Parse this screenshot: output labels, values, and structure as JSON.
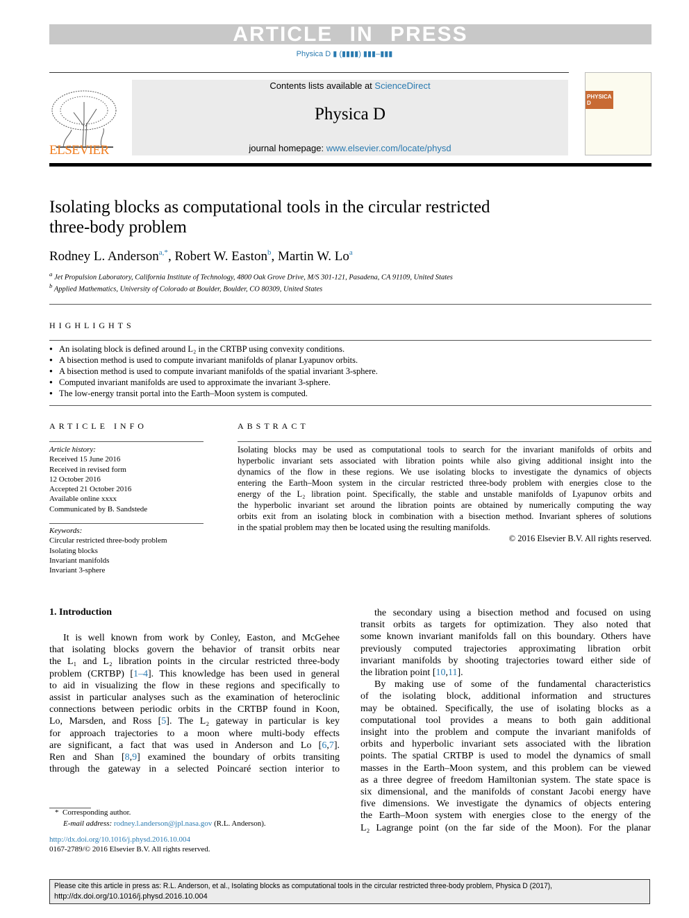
{
  "banner": {
    "article_in_press": "ARTICLE IN PRESS",
    "journal_ref": "Physica D ▮ (▮▮▮▮) ▮▮▮–▮▮▮"
  },
  "masthead": {
    "contents_prefix": "Contents lists available at ",
    "sciencedirect": "ScienceDirect",
    "journal_title": "Physica D",
    "homepage_prefix": "journal homepage: ",
    "homepage_url": "www.elsevier.com/locate/physd",
    "publisher_logo": "ELSEVIER",
    "cover_label": "PHYSICA D"
  },
  "article": {
    "title_lines": [
      "Isolating blocks as computational tools in the circular restricted",
      "three-body problem"
    ],
    "authors": [
      {
        "name": "Rodney L. Anderson",
        "sup": "a,*"
      },
      {
        "name": "Robert W. Easton",
        "sup": "b"
      },
      {
        "name": "Martin W. Lo",
        "sup": "a"
      }
    ],
    "affiliations": [
      {
        "sup": "a",
        "text": "Jet Propulsion Laboratory, California Institute of Technology, 4800 Oak Grove Drive, M/S 301-121, Pasadena, CA 91109, United States"
      },
      {
        "sup": "b",
        "text": "Applied Mathematics, University of Colorado at Boulder, Boulder, CO 80309, United States"
      }
    ]
  },
  "highlights": {
    "heading": "HIGHLIGHTS",
    "items": [
      "An isolating block is defined around L₂ in the CRTBP using convexity conditions.",
      "A bisection method is used to compute invariant manifolds of planar Lyapunov orbits.",
      "A bisection method is used to compute invariant manifolds of the spatial invariant 3-sphere.",
      "Computed invariant manifolds are used to approximate the invariant 3-sphere.",
      "The low-energy transit portal into the Earth–Moon system is computed."
    ]
  },
  "article_info": {
    "heading": "ARTICLE INFO",
    "history_label": "Article history:",
    "history": [
      "Received 15 June 2016",
      "Received in revised form",
      "12 October 2016",
      "Accepted 21 October 2016",
      "Available online xxxx",
      "Communicated by B. Sandstede"
    ],
    "keywords_label": "Keywords:",
    "keywords": [
      "Circular restricted three-body problem",
      "Isolating blocks",
      "Invariant manifolds",
      "Invariant 3-sphere"
    ]
  },
  "abstract": {
    "heading": "ABSTRACT",
    "paragraphs": [
      [
        [
          "Isolating blocks may be used as computational tools to search for the invariant manifolds of orbits and"
        ],
        [
          "hyperbolic invariant sets associated with libration points while also giving additional insight into the"
        ],
        [
          "dynamics of the flow in these regions. We use isolating blocks to investigate the dynamics of objects"
        ],
        [
          "entering the Earth–Moon system in the circular restricted three-body problem with energies close to the"
        ],
        [
          "energy of the L₂ libration point. Specifically, the stable and unstable manifolds of Lyapunov orbits and"
        ],
        [
          "the hyperbolic invariant set around the libration points are obtained by numerically computing the way"
        ],
        [
          "orbits exit from an isolating block in combination with a bisection method. Invariant spheres of solutions"
        ],
        [
          "in the spatial problem may then be located using the resulting manifolds."
        ]
      ]
    ],
    "copyright": "© 2016 Elsevier B.V. All rights reserved."
  },
  "intro": {
    "heading": "1.  Introduction",
    "left": [
      [
        [
          "It is well known from work by Conley, Easton, and McGehee"
        ],
        [
          "that isolating blocks govern the behavior of transit orbits near"
        ],
        [
          "the L₁ and L₂ libration points in the circular restricted three-body"
        ],
        [
          "problem (CRTBP) [",
          {
            "t": "1–4"
          },
          "]. This knowledge has been used in general"
        ],
        [
          "to aid in visualizing the flow in these regions and specifically to"
        ],
        [
          "assist in particular analyses such as the examination of heteroclinic"
        ],
        [
          "connections between periodic orbits in the CRTBP found in Koon,"
        ],
        [
          "Lo, Marsden, and Ross [",
          {
            "t": "5"
          },
          "]. The L₂ gateway in particular is key"
        ],
        [
          "for approach trajectories to a moon where multi-body effects"
        ],
        [
          "are significant, a fact that was used in Anderson and Lo [",
          {
            "t": "6"
          },
          ",",
          {
            "t": "7"
          },
          "]."
        ],
        [
          "Ren and Shan [",
          {
            "t": "8"
          },
          ",",
          {
            "t": "9"
          },
          "] examined the boundary of orbits transiting"
        ],
        [
          "through the gateway in a selected Poincaré section interior to"
        ]
      ]
    ],
    "right": [
      [
        [
          "the secondary using a bisection method and focused on using"
        ],
        [
          "transit orbits as targets for optimization. They also noted that"
        ],
        [
          "some known invariant manifolds fall on this boundary. Others have"
        ],
        [
          "previously computed trajectories approximating libration orbit"
        ],
        [
          "invariant manifolds by shooting trajectories toward either side of"
        ],
        [
          "the libration point [",
          {
            "t": "10"
          },
          ",",
          {
            "t": "11"
          },
          "]."
        ]
      ],
      [
        [
          "By making use of some of the fundamental characteristics"
        ],
        [
          "of the isolating block, additional information and structures"
        ],
        [
          "may be obtained. Specifically, the use of isolating blocks as a"
        ],
        [
          "computational tool provides a means to both gain additional"
        ],
        [
          "insight into the problem and compute the invariant manifolds of"
        ],
        [
          "orbits and hyperbolic invariant sets associated with the libration"
        ],
        [
          "points. The spatial CRTBP is used to model the dynamics of small"
        ],
        [
          "masses in the Earth–Moon system, and this problem can be viewed"
        ],
        [
          "as a three degree of freedom Hamiltonian system. The state space is"
        ],
        [
          "six dimensional, and the manifolds of constant Jacobi energy have"
        ],
        [
          "five dimensions. We investigate the dynamics of objects entering"
        ],
        [
          "the Earth–Moon system with energies close to the energy of the"
        ],
        [
          "L₂ Lagrange point (on the far side of the Moon). For the planar"
        ]
      ]
    ]
  },
  "footnote": {
    "star": "*",
    "corresponding": "Corresponding author.",
    "email_label": "E-mail address: ",
    "email": "rodney.l.anderson@jpl.nasa.gov",
    "email_suffix": " (R.L. Anderson).",
    "doi": "http://dx.doi.org/10.1016/j.physd.2016.10.004",
    "issn": "0167-2789/© 2016 Elsevier B.V. All rights reserved."
  },
  "cite_box": {
    "line1": "Please cite this article in press as: R.L. Anderson, et al., Isolating blocks as computational tools in the circular restricted three-body problem, Physica D (2017),",
    "line2": "http://dx.doi.org/10.1016/j.physd.2016.10.004"
  },
  "colors": {
    "link": "#2a7ab0",
    "elsevier_orange": "#f07d1f",
    "banner_gray": "#c8c8c8"
  }
}
